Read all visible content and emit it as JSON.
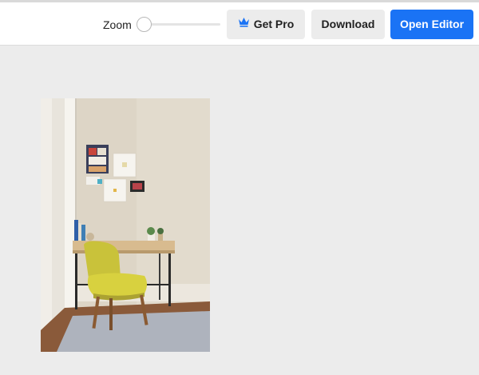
{
  "toolbar": {
    "zoom_label": "Zoom",
    "zoom_level": 0,
    "get_pro_label": "Get Pro",
    "download_label": "Download",
    "open_editor_label": "Open Editor"
  },
  "icons": {
    "crown": "crown-icon"
  },
  "colors": {
    "primary": "#1a73f5",
    "crown": "#1a73f5",
    "canvas_bg": "#ececec"
  }
}
